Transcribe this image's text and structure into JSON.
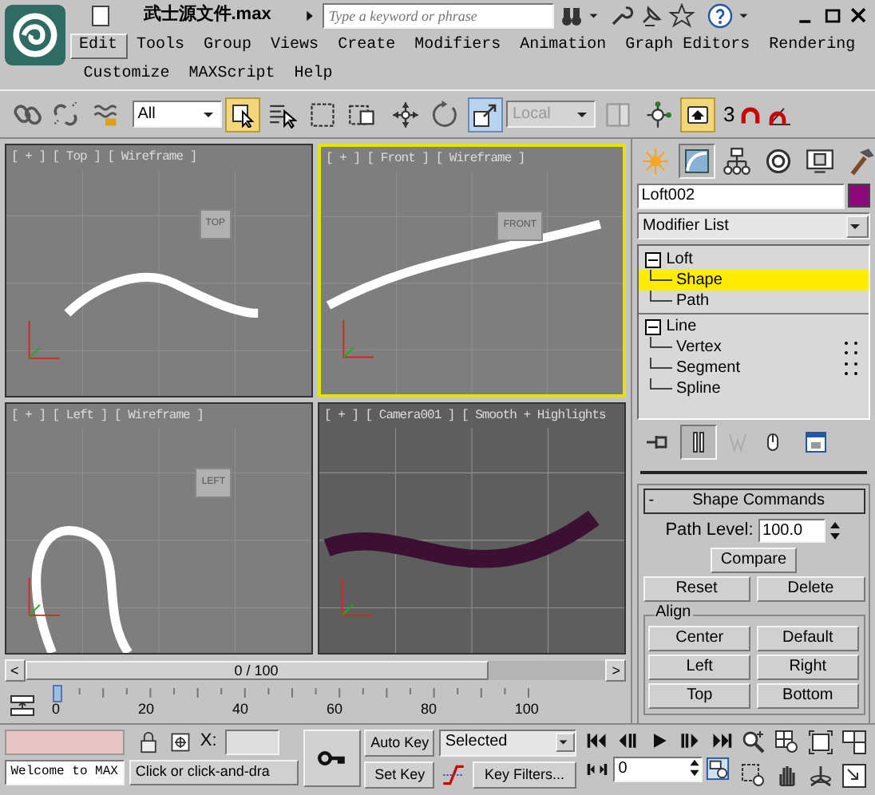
{
  "title_bar": {
    "title": "武士源文件.max",
    "search": {
      "placeholder": "Type a keyword or phrase"
    }
  },
  "menu": [
    {
      "label": "Edit",
      "selected": true
    },
    {
      "label": "Tools",
      "selected": false
    },
    {
      "label": "Group",
      "selected": false
    },
    {
      "label": "Views",
      "selected": false
    },
    {
      "label": "Create",
      "selected": false
    },
    {
      "label": "Modifiers",
      "selected": false
    },
    {
      "label": "Animation",
      "selected": false
    },
    {
      "label": "Graph Editors",
      "selected": false
    },
    {
      "label": "Rendering",
      "selected": false
    },
    {
      "label": "Customize",
      "selected": false
    },
    {
      "label": "MAXScript",
      "selected": false
    },
    {
      "label": "Help",
      "selected": false
    }
  ],
  "toolbar": {
    "selection_filter": "All",
    "reference_coordinate_system": {
      "value": "Local",
      "disabled": true
    },
    "snap_toggle": "3"
  },
  "viewports": [
    {
      "label": "[ + ] [ Top ] [ Wireframe ]",
      "active": false,
      "kind": "wireframe",
      "view_cube": "TOP"
    },
    {
      "label": "[ + ] [ Front ] [ Wireframe ]",
      "active": true,
      "kind": "wireframe",
      "view_cube": "FRONT"
    },
    {
      "label": "[ + ] [ Left ] [ Wireframe ]",
      "active": false,
      "kind": "wireframe",
      "view_cube": "LEFT"
    },
    {
      "label": "[ + ] [ Camera001 ] [ Smooth + Highlights",
      "active": false,
      "kind": "smooth"
    }
  ],
  "command_panel": {
    "tabs": [
      {
        "selected": false
      },
      {
        "selected": true
      },
      {
        "selected": false
      },
      {
        "selected": false
      },
      {
        "selected": false
      },
      {
        "selected": false
      }
    ],
    "object_name": "Loft002",
    "modifier_list": "Modifier List",
    "stack": [
      {
        "label": "Loft",
        "expanded": true,
        "children": [
          {
            "label": "Shape",
            "selected": true
          },
          {
            "label": "Path",
            "selected": false
          }
        ]
      },
      {
        "label": "Line",
        "expanded": true,
        "children": [
          {
            "label": "Vertex",
            "selected": false
          },
          {
            "label": "Segment",
            "selected": false
          },
          {
            "label": "Spline",
            "selected": false
          }
        ]
      }
    ],
    "rollout": {
      "toggle": "-",
      "title": "Shape Commands",
      "path_level_label": "Path Level:",
      "path_level": "100.0",
      "compare": "Compare",
      "buttons": [
        "Reset",
        "Delete"
      ],
      "align": {
        "title": "Align",
        "buttons": [
          "Center",
          "Default",
          "Left",
          "Right",
          "Top",
          "Bottom"
        ]
      }
    }
  },
  "time_slider": {
    "prev": "<",
    "position": "0 / 100",
    "next": ">",
    "level": 0
  },
  "track_bar": {
    "ticks": [
      "0",
      "20",
      "40",
      "60",
      "80",
      "100"
    ]
  },
  "status": {
    "script_output": "Welcome to MAX",
    "x_label": "X:",
    "prompt": "Click or click-and-dra",
    "auto_key": "Auto Key",
    "set_key": "Set Key",
    "key_mode": "Selected",
    "key_filters": "Key Filters...",
    "frame": "0"
  }
}
